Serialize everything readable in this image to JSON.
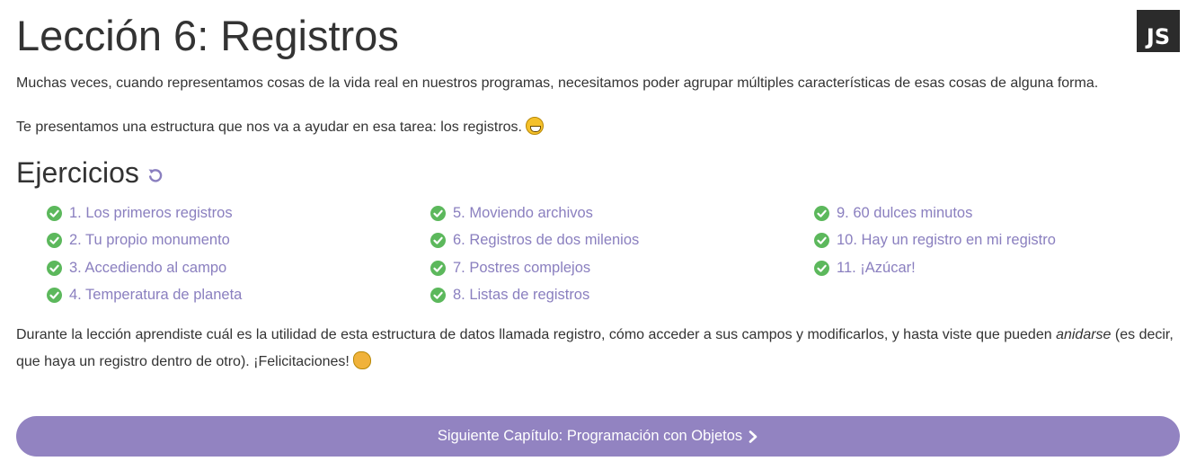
{
  "lesson": {
    "title": "Lección 6: Registros",
    "language_badge": "JS",
    "intro_1": "Muchas veces, cuando representamos cosas de la vida real en nuestros programas, necesitamos poder agrupar múltiples características de esas cosas de alguna forma.",
    "intro_2": "Te presentamos una estructura que nos va a ayudar en esa tarea: los registros.",
    "intro_2_emoji": "grinning-face-emoji"
  },
  "exercises": {
    "title": "Ejercicios",
    "reset_icon": "reset-icon",
    "status_icon": "check-circle-icon",
    "status_color": "#5cb85c",
    "link_color": "#8a7fbf",
    "columns": [
      [
        "1. Los primeros registros",
        "2. Tu propio monumento",
        "3. Accediendo al campo",
        "4. Temperatura de planeta"
      ],
      [
        "5. Moviendo archivos",
        "6. Registros de dos milenios",
        "7. Postres complejos",
        "8. Listas de registros"
      ],
      [
        "9. 60 dulces minutos",
        "10. Hay un registro en mi registro",
        "11. ¡Azúcar!"
      ]
    ]
  },
  "outro": {
    "text_before": "Durante la lección aprendiste cuál es la utilidad de esta estructura de datos llamada registro, cómo acceder a sus campos y modificarlos, y hasta viste que pueden ",
    "emphasis": "anidarse",
    "text_after": " (es decir, que haya un registro dentro de otro). ¡Felicitaciones!",
    "emoji": "clapping-hands-emoji"
  },
  "next_button": {
    "label": "Siguiente Capítulo: Programación con Objetos",
    "icon": "chevron-right-icon",
    "color": "#9283c1"
  }
}
